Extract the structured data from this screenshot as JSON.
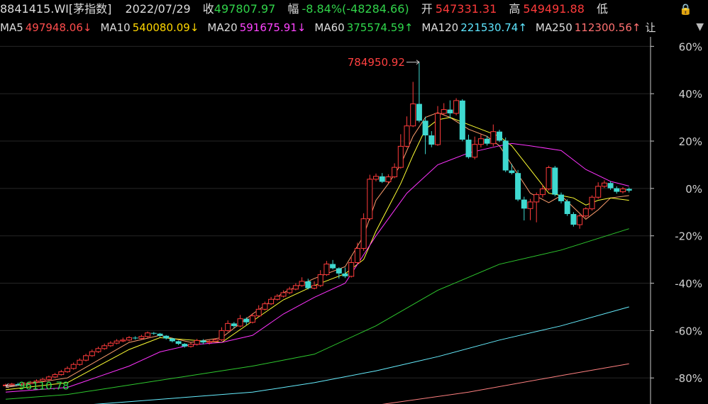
{
  "header": {
    "code": "8841415.WI[茅指数]",
    "date": "2022/07/29",
    "close_label": "收",
    "close_value": "497807.97",
    "change_label": "幅",
    "change_value": "-8.84%(-48284.66)",
    "open_label": "开",
    "open_value": "547331.31",
    "high_label": "高",
    "high_value": "549491.88",
    "low_label": "低"
  },
  "ma_bar": [
    {
      "label": "MA5",
      "value": "497948.06↓",
      "color": "#ff4d4d"
    },
    {
      "label": "MA10",
      "value": "540080.09↓",
      "color": "#ffd700"
    },
    {
      "label": "MA20",
      "value": "591675.91↓",
      "color": "#ff44ff"
    },
    {
      "label": "MA60",
      "value": "375574.59↑",
      "color": "#2fd94c"
    },
    {
      "label": "MA120",
      "value": "221530.74↑",
      "color": "#5ee6ff"
    },
    {
      "label": "MA250",
      "value": "112300.56↑",
      "color": "#ff7070"
    }
  ],
  "ma_bar_overflow": "让",
  "colors": {
    "up": "#ff3b3b",
    "down": "#3fd9d0",
    "ma5": "#ff9f6e",
    "ma10": "#ffff33",
    "ma20": "#ff33ff",
    "ma60": "#2ec82e",
    "ma120": "#66eeff",
    "ma250": "#ff8080"
  },
  "icons": [
    "lock-icon",
    "triangle-down-icon"
  ],
  "chart_data": {
    "type": "candlestick",
    "y_axis": {
      "position": "right",
      "scale": "percent",
      "ticks": [
        "60%",
        "40%",
        "20%",
        "0%",
        "-20%",
        "-40%",
        "-60%",
        "-80%"
      ],
      "tick_values": [
        60,
        40,
        20,
        0,
        -20,
        -40,
        -60,
        -80
      ],
      "ylim": [
        -91,
        64
      ]
    },
    "annotations": {
      "max": {
        "label": "784950.92",
        "value": 53
      },
      "min": {
        "label": "96110.78",
        "value": -83
      }
    },
    "candles": [
      [
        -83.2,
        -83.0,
        -82.4,
        -83.6
      ],
      [
        -83.0,
        -82.6,
        -82.1,
        -83.4
      ],
      [
        -82.6,
        -83.0,
        -82.0,
        -83.3
      ],
      [
        -82.9,
        -82.3,
        -81.8,
        -83.2
      ],
      [
        -82.3,
        -81.8,
        -81.3,
        -82.7
      ],
      [
        -81.8,
        -81.3,
        -80.6,
        -82.2
      ],
      [
        -81.3,
        -80.6,
        -79.9,
        -81.7
      ],
      [
        -80.6,
        -79.6,
        -79.0,
        -81.0
      ],
      [
        -79.6,
        -78.6,
        -77.9,
        -80.1
      ],
      [
        -78.6,
        -77.4,
        -76.6,
        -79.0
      ],
      [
        -77.4,
        -76.0,
        -75.1,
        -77.8
      ],
      [
        -76.0,
        -74.3,
        -73.5,
        -76.5
      ],
      [
        -74.3,
        -72.5,
        -71.7,
        -74.8
      ],
      [
        -72.5,
        -70.6,
        -69.8,
        -73.0
      ],
      [
        -70.6,
        -68.9,
        -68.0,
        -71.1
      ],
      [
        -68.9,
        -67.6,
        -66.8,
        -69.4
      ],
      [
        -67.6,
        -66.4,
        -65.5,
        -68.1
      ],
      [
        -66.4,
        -65.3,
        -64.5,
        -66.9
      ],
      [
        -65.3,
        -64.4,
        -63.6,
        -65.8
      ],
      [
        -64.4,
        -64.0,
        -63.0,
        -64.9
      ],
      [
        -64.0,
        -63.0,
        -62.3,
        -64.5
      ],
      [
        -63.0,
        -63.3,
        -62.4,
        -63.8
      ],
      [
        -63.3,
        -62.5,
        -61.8,
        -63.8
      ],
      [
        -62.5,
        -61.0,
        -60.4,
        -63.0
      ],
      [
        -61.0,
        -61.3,
        -60.6,
        -61.8
      ],
      [
        -61.3,
        -62.2,
        -61.0,
        -62.7
      ],
      [
        -62.2,
        -63.3,
        -61.9,
        -63.8
      ],
      [
        -63.3,
        -64.5,
        -63.1,
        -65.0
      ],
      [
        -64.5,
        -65.6,
        -64.2,
        -66.1
      ],
      [
        -65.6,
        -66.7,
        -65.3,
        -67.2
      ],
      [
        -66.7,
        -65.8,
        -65.1,
        -67.2
      ],
      [
        -65.8,
        -64.2,
        -63.5,
        -66.3
      ],
      [
        -64.2,
        -65.0,
        -63.6,
        -65.8
      ],
      [
        -65.0,
        -64.6,
        -64.0,
        -65.9
      ],
      [
        -64.6,
        -63.9,
        -63.2,
        -65.1
      ],
      [
        -63.9,
        -60.0,
        -58.6,
        -64.4
      ],
      [
        -60.0,
        -57.0,
        -55.7,
        -60.5
      ],
      [
        -57.0,
        -58.1,
        -56.4,
        -58.9
      ],
      [
        -58.1,
        -55.0,
        -53.4,
        -58.6
      ],
      [
        -55.0,
        -56.5,
        -54.4,
        -57.6
      ],
      [
        -56.5,
        -53.8,
        -52.7,
        -57.0
      ],
      [
        -53.8,
        -51.0,
        -49.3,
        -54.3
      ],
      [
        -51.0,
        -48.7,
        -47.8,
        -51.5
      ],
      [
        -48.7,
        -46.8,
        -45.8,
        -49.2
      ],
      [
        -46.8,
        -45.5,
        -44.6,
        -47.3
      ],
      [
        -45.5,
        -44.0,
        -43.0,
        -46.0
      ],
      [
        -44.0,
        -42.5,
        -41.5,
        -44.6
      ],
      [
        -42.5,
        -41.0,
        -40.0,
        -43.0
      ],
      [
        -41.0,
        -39.2,
        -37.5,
        -41.5
      ],
      [
        -39.2,
        -42.1,
        -38.1,
        -42.6
      ],
      [
        -42.1,
        -41.0,
        -39.2,
        -42.6
      ],
      [
        -41.0,
        -36.4,
        -34.5,
        -41.6
      ],
      [
        -36.4,
        -31.9,
        -30.6,
        -36.9
      ],
      [
        -31.9,
        -33.7,
        -30.2,
        -34.2
      ],
      [
        -33.7,
        -35.9,
        -33.3,
        -38.0
      ],
      [
        -35.9,
        -37.1,
        -33.4,
        -37.8
      ],
      [
        -37.1,
        -31.3,
        -29.1,
        -37.6
      ],
      [
        -31.3,
        -25.3,
        -22.9,
        -31.8
      ],
      [
        -25.3,
        -12.8,
        -10.5,
        -26.3
      ],
      [
        -12.8,
        3.9,
        5.8,
        -13.5
      ],
      [
        3.9,
        5.1,
        6.3,
        3.0
      ],
      [
        5.1,
        2.8,
        6.5,
        2.3
      ],
      [
        2.8,
        4.9,
        6.0,
        2.3
      ],
      [
        4.9,
        8.9,
        10.6,
        4.3
      ],
      [
        8.9,
        17.8,
        22.9,
        8.4
      ],
      [
        17.8,
        26.4,
        30.4,
        17.3
      ],
      [
        26.4,
        35.7,
        45.0,
        25.9
      ],
      [
        35.7,
        28.6,
        53.0,
        27.9
      ],
      [
        28.6,
        22.4,
        30.3,
        14.5
      ],
      [
        22.4,
        18.5,
        24.2,
        17.4
      ],
      [
        18.5,
        31.7,
        34.8,
        18.0
      ],
      [
        31.7,
        33.3,
        36.0,
        31.0
      ],
      [
        33.3,
        31.7,
        37.2,
        29.5
      ],
      [
        31.7,
        37.1,
        38.1,
        30.9
      ],
      [
        37.1,
        20.6,
        37.7,
        19.9
      ],
      [
        20.6,
        13.2,
        22.7,
        12.6
      ],
      [
        13.2,
        18.6,
        21.9,
        12.3
      ],
      [
        18.6,
        21.0,
        22.8,
        17.3
      ],
      [
        21.0,
        18.9,
        22.2,
        18.1
      ],
      [
        18.9,
        24.0,
        27.0,
        17.8
      ],
      [
        24.0,
        20.2,
        24.8,
        19.6
      ],
      [
        20.2,
        7.6,
        21.5,
        6.9
      ],
      [
        7.6,
        6.5,
        10.4,
        5.9
      ],
      [
        6.5,
        -4.7,
        7.8,
        -5.4
      ],
      [
        -4.7,
        -8.5,
        -3.5,
        -13.5
      ],
      [
        -8.5,
        -5.7,
        -4.4,
        -13.4
      ],
      [
        -5.7,
        -2.6,
        -1.7,
        -14.3
      ],
      [
        -2.6,
        -0.2,
        1.6,
        -3.8
      ],
      [
        -0.2,
        8.8,
        9.6,
        -0.9
      ],
      [
        8.8,
        -2.6,
        9.5,
        -3.3
      ],
      [
        -2.6,
        -5.4,
        -1.7,
        -6.3
      ],
      [
        -5.4,
        -10.8,
        -4.6,
        -11.6
      ],
      [
        -10.8,
        -15.3,
        -10.0,
        -16.1
      ],
      [
        -15.3,
        -11.6,
        -10.9,
        -17.0
      ],
      [
        -11.6,
        -8.6,
        -7.9,
        -12.4
      ],
      [
        -8.6,
        -3.7,
        -2.9,
        -9.3
      ],
      [
        -3.7,
        0.9,
        2.6,
        -4.4
      ],
      [
        0.9,
        2.3,
        3.4,
        0.2
      ],
      [
        2.3,
        0.1,
        3.1,
        -0.6
      ],
      [
        0.1,
        -1.4,
        0.9,
        -2.2
      ],
      [
        -1.4,
        -0.2,
        0.6,
        -2.1
      ],
      [
        -0.2,
        -0.9,
        0.4,
        -1.7
      ]
    ],
    "series": [
      {
        "name": "MA5",
        "color_key": "ma5",
        "x": [
          0,
          10,
          20,
          25,
          30,
          35,
          40,
          45,
          50,
          55,
          58,
          60,
          62,
          64,
          66,
          68,
          70,
          72,
          75,
          78,
          80,
          82,
          85,
          88,
          90,
          92,
          94,
          96,
          98,
          101
        ],
        "values": [
          -84,
          -80,
          -65,
          -62,
          -65,
          -63,
          -53,
          -44,
          -38,
          -33,
          -20,
          -5,
          2,
          10,
          22,
          30,
          32,
          30,
          25,
          22,
          18,
          10,
          -2,
          -6,
          -3,
          -8,
          -13,
          -9,
          -4,
          -3
        ]
      },
      {
        "name": "MA10",
        "color_key": "ma10",
        "x": [
          0,
          10,
          20,
          25,
          30,
          35,
          40,
          45,
          50,
          55,
          58,
          60,
          62,
          64,
          66,
          68,
          70,
          72,
          75,
          78,
          80,
          82,
          85,
          88,
          90,
          92,
          94,
          96,
          98,
          101
        ],
        "values": [
          -85,
          -82,
          -68,
          -63,
          -64,
          -65,
          -56,
          -47,
          -41,
          -36,
          -30,
          -18,
          -8,
          2,
          14,
          25,
          29,
          30,
          27,
          24,
          22,
          18,
          8,
          -2,
          -3,
          -4,
          -7,
          -5,
          -4,
          -5
        ]
      },
      {
        "name": "MA20",
        "color_key": "ma20",
        "x": [
          0,
          10,
          20,
          25,
          30,
          35,
          40,
          45,
          50,
          55,
          60,
          65,
          70,
          75,
          80,
          82,
          85,
          90,
          94,
          98,
          101
        ],
        "values": [
          -86,
          -84,
          -75,
          -69,
          -66,
          -65,
          -62,
          -53,
          -46,
          -40,
          -20,
          -2,
          10,
          15,
          18,
          19,
          18,
          16,
          8,
          3,
          1
        ]
      },
      {
        "name": "MA60",
        "color_key": "ma60",
        "x": [
          0,
          10,
          20,
          30,
          40,
          50,
          60,
          70,
          80,
          90,
          101
        ],
        "values": [
          -89,
          -87,
          -83,
          -79,
          -75,
          -70,
          -58,
          -43,
          -32,
          -26,
          -17
        ]
      },
      {
        "name": "MA120",
        "color_key": "ma120",
        "x": [
          0,
          10,
          20,
          30,
          40,
          50,
          60,
          70,
          80,
          90,
          101
        ],
        "values": [
          -94,
          -92,
          -90,
          -88,
          -86,
          -82,
          -77,
          -71,
          -64,
          -58,
          -50
        ]
      },
      {
        "name": "MA250",
        "color_key": "ma250",
        "x": [
          15,
          30,
          45,
          60,
          75,
          90,
          101
        ],
        "values": [
          -95.5,
          -95,
          -94,
          -91.5,
          -86,
          -79,
          -74
        ]
      }
    ]
  }
}
